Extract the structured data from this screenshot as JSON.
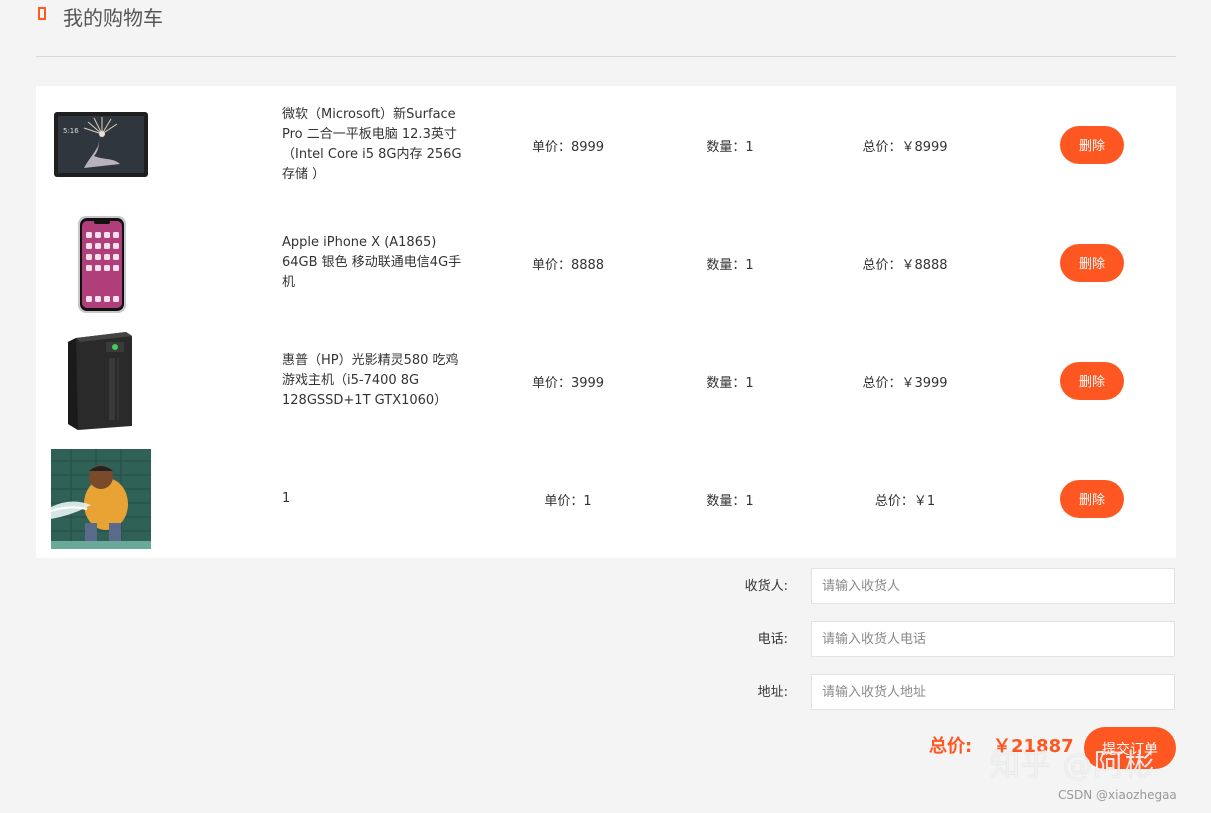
{
  "header": {
    "title": "我的购物车"
  },
  "cart": {
    "items": [
      {
        "name": "微软（Microsoft）新Surface Pro 二合一平板电脑 12.3英寸（Intel Core i5 8G内存 256G存储 ）",
        "price": "单价：8999",
        "qty": "数量：1",
        "total": "总价：￥8999",
        "delete_label": "删除",
        "image": "surface-pro-tablet"
      },
      {
        "name": "Apple iPhone X (A1865) 64GB 银色 移动联通电信4G手机",
        "price": "单价：8888",
        "qty": "数量：1",
        "total": "总价：￥8888",
        "delete_label": "删除",
        "image": "iphone-x"
      },
      {
        "name": "惠普（HP）光影精灵580 吃鸡游戏主机（i5-7400 8G 128GSSD+1T GTX1060）",
        "price": "单价：3999",
        "qty": "数量：1",
        "total": "总价：￥3999",
        "delete_label": "删除",
        "image": "hp-desktop-tower"
      },
      {
        "name": "1",
        "price": "单价：1",
        "qty": "数量：1",
        "total": "总价：￥1",
        "delete_label": "删除",
        "image": "cartoon-meme"
      }
    ]
  },
  "form": {
    "receiver": {
      "label": "收货人:",
      "placeholder": "请输入收货人"
    },
    "phone": {
      "label": "电话:",
      "placeholder": "请输入收货人电话"
    },
    "address": {
      "label": "地址:",
      "placeholder": "请输入收货人地址"
    }
  },
  "summary": {
    "total_label": "总价:",
    "total_value": "￥21887",
    "submit_label": "提交订单"
  },
  "watermarks": {
    "zhihu": "知乎 @阿彬",
    "csdn": "CSDN @xiaozhegaa"
  },
  "colors": {
    "accent": "#ff5722",
    "background": "#f4f4f4"
  }
}
